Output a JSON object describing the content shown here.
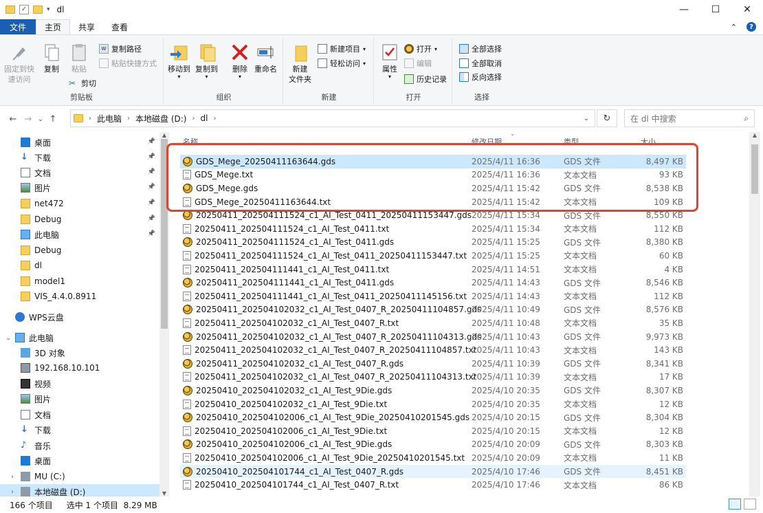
{
  "window": {
    "title": "dl",
    "minimize": "—",
    "maximize": "☐",
    "close": "✕"
  },
  "tabs": {
    "file": "文件",
    "home": "主页",
    "share": "共享",
    "view": "查看",
    "collapse": "⌃"
  },
  "ribbon": {
    "clipboard": {
      "label": "剪贴板",
      "pin": "固定到快\n速访问",
      "copy": "复制",
      "paste": "粘贴",
      "copy_path": "复制路径",
      "paste_shortcut": "粘贴快捷方式",
      "cut": "剪切"
    },
    "organize": {
      "label": "组织",
      "move_to": "移动到",
      "copy_to": "复制到",
      "delete": "删除",
      "rename": "重命名"
    },
    "new": {
      "label": "新建",
      "new_folder": "新建\n文件夹",
      "new_item": "新建项目",
      "easy_access": "轻松访问"
    },
    "open": {
      "label": "打开",
      "properties": "属性",
      "open": "打开",
      "edit": "编辑",
      "history": "历史记录"
    },
    "select": {
      "label": "选择",
      "select_all": "全部选择",
      "select_none": "全部取消",
      "invert": "反向选择"
    }
  },
  "address": {
    "back": "←",
    "forward": "→",
    "recent": "⌄",
    "up": "↑",
    "crumbs": [
      "此电脑",
      "本地磁盘 (D:)",
      "dl"
    ],
    "refresh": "↻",
    "search_placeholder": "在 dl 中搜索",
    "search_icon": "⌕"
  },
  "nav": {
    "items": [
      {
        "label": "桌面",
        "icon": "desktop-icon",
        "pinned": true
      },
      {
        "label": "下载",
        "icon": "download-icon",
        "pinned": true
      },
      {
        "label": "文档",
        "icon": "document-icon",
        "pinned": true
      },
      {
        "label": "图片",
        "icon": "picture-icon",
        "pinned": true
      },
      {
        "label": "net472",
        "icon": "folder-icon",
        "pinned": true
      },
      {
        "label": "Debug",
        "icon": "folder-icon",
        "pinned": true
      },
      {
        "label": "此电脑",
        "icon": "computer-icon",
        "pinned": true
      },
      {
        "label": "Debug",
        "icon": "folder-icon",
        "pinned": false
      },
      {
        "label": "dl",
        "icon": "folder-icon",
        "pinned": false
      },
      {
        "label": "model1",
        "icon": "folder-icon",
        "pinned": false
      },
      {
        "label": "VIS_4.4.0.8911",
        "icon": "folder-icon",
        "pinned": false
      },
      {
        "label": "WPS云盘",
        "icon": "cloud-icon",
        "pinned": false
      },
      {
        "label": "此电脑",
        "icon": "computer-icon",
        "pinned": false
      },
      {
        "label": "3D 对象",
        "icon": "cube-icon",
        "pinned": false
      },
      {
        "label": "192.168.10.101",
        "icon": "network-drive-icon",
        "pinned": false
      },
      {
        "label": "视频",
        "icon": "video-icon",
        "pinned": false
      },
      {
        "label": "图片",
        "icon": "picture-icon",
        "pinned": false
      },
      {
        "label": "文档",
        "icon": "document-icon",
        "pinned": false
      },
      {
        "label": "下载",
        "icon": "download-icon",
        "pinned": false
      },
      {
        "label": "音乐",
        "icon": "music-icon",
        "pinned": false
      },
      {
        "label": "桌面",
        "icon": "desktop-icon",
        "pinned": false
      },
      {
        "label": "MU (C:)",
        "icon": "drive-icon",
        "pinned": false
      },
      {
        "label": "本地磁盘 (D:)",
        "icon": "drive-icon",
        "pinned": false
      }
    ]
  },
  "columns": {
    "name": "名称",
    "date": "修改日期",
    "type": "类型",
    "size": "大小"
  },
  "files": [
    {
      "name": "GDS_Mege_20250411163644.gds",
      "date": "2025/4/11 16:36",
      "type": "GDS 文件",
      "size": "8,497 KB",
      "kind": "gds"
    },
    {
      "name": "GDS_Mege.txt",
      "date": "2025/4/11 16:36",
      "type": "文本文档",
      "size": "93 KB",
      "kind": "txt"
    },
    {
      "name": "GDS_Mege.gds",
      "date": "2025/4/11 15:42",
      "type": "GDS 文件",
      "size": "8,538 KB",
      "kind": "gds"
    },
    {
      "name": "GDS_Mege_20250411163644.txt",
      "date": "2025/4/11 15:42",
      "type": "文本文档",
      "size": "109 KB",
      "kind": "txt"
    },
    {
      "name": "20250411_202504111524_c1_AI_Test_0411_20250411153447.gds",
      "date": "2025/4/11 15:34",
      "type": "GDS 文件",
      "size": "8,550 KB",
      "kind": "gds"
    },
    {
      "name": "20250411_202504111524_c1_AI_Test_0411.txt",
      "date": "2025/4/11 15:34",
      "type": "文本文档",
      "size": "112 KB",
      "kind": "txt"
    },
    {
      "name": "20250411_202504111524_c1_AI_Test_0411.gds",
      "date": "2025/4/11 15:25",
      "type": "GDS 文件",
      "size": "8,380 KB",
      "kind": "gds"
    },
    {
      "name": "20250411_202504111524_c1_AI_Test_0411_20250411153447.txt",
      "date": "2025/4/11 15:25",
      "type": "文本文档",
      "size": "60 KB",
      "kind": "txt"
    },
    {
      "name": "20250411_202504111441_c1_AI_Test_0411.txt",
      "date": "2025/4/11 14:51",
      "type": "文本文档",
      "size": "4 KB",
      "kind": "txt"
    },
    {
      "name": "20250411_202504111441_c1_AI_Test_0411.gds",
      "date": "2025/4/11 14:43",
      "type": "GDS 文件",
      "size": "8,546 KB",
      "kind": "gds"
    },
    {
      "name": "20250411_202504111441_c1_AI_Test_0411_20250411145156.txt",
      "date": "2025/4/11 14:43",
      "type": "文本文档",
      "size": "112 KB",
      "kind": "txt"
    },
    {
      "name": "20250411_202504102032_c1_AI_Test_0407_R_20250411104857.gds",
      "date": "2025/4/11 10:49",
      "type": "GDS 文件",
      "size": "8,576 KB",
      "kind": "gds"
    },
    {
      "name": "20250411_202504102032_c1_AI_Test_0407_R.txt",
      "date": "2025/4/11 10:48",
      "type": "文本文档",
      "size": "35 KB",
      "kind": "txt"
    },
    {
      "name": "20250411_202504102032_c1_AI_Test_0407_R_20250411104313.gds",
      "date": "2025/4/11 10:43",
      "type": "GDS 文件",
      "size": "9,973 KB",
      "kind": "gds"
    },
    {
      "name": "20250411_202504102032_c1_AI_Test_0407_R_20250411104857.txt",
      "date": "2025/4/11 10:43",
      "type": "文本文档",
      "size": "143 KB",
      "kind": "txt"
    },
    {
      "name": "20250411_202504102032_c1_AI_Test_0407_R.gds",
      "date": "2025/4/11 10:39",
      "type": "GDS 文件",
      "size": "8,341 KB",
      "kind": "gds"
    },
    {
      "name": "20250411_202504102032_c1_AI_Test_0407_R_20250411104313.txt",
      "date": "2025/4/11 10:39",
      "type": "文本文档",
      "size": "17 KB",
      "kind": "txt"
    },
    {
      "name": "20250410_202504102032_c1_AI_Test_9Die.gds",
      "date": "2025/4/10 20:35",
      "type": "GDS 文件",
      "size": "8,307 KB",
      "kind": "gds"
    },
    {
      "name": "20250410_202504102032_c1_AI_Test_9Die.txt",
      "date": "2025/4/10 20:35",
      "type": "文本文档",
      "size": "12 KB",
      "kind": "txt"
    },
    {
      "name": "20250410_202504102006_c1_AI_Test_9Die_20250410201545.gds",
      "date": "2025/4/10 20:15",
      "type": "GDS 文件",
      "size": "8,304 KB",
      "kind": "gds"
    },
    {
      "name": "20250410_202504102006_c1_AI_Test_9Die.txt",
      "date": "2025/4/10 20:15",
      "type": "文本文档",
      "size": "12 KB",
      "kind": "txt"
    },
    {
      "name": "20250410_202504102006_c1_AI_Test_9Die.gds",
      "date": "2025/4/10 20:09",
      "type": "GDS 文件",
      "size": "8,303 KB",
      "kind": "gds"
    },
    {
      "name": "20250410_202504102006_c1_AI_Test_9Die_20250410201545.txt",
      "date": "2025/4/10 20:09",
      "type": "文本文档",
      "size": "11 KB",
      "kind": "txt"
    },
    {
      "name": "20250410_202504101744_c1_AI_Test_0407_R.gds",
      "date": "2025/4/10 17:46",
      "type": "GDS 文件",
      "size": "8,451 KB",
      "kind": "gds"
    },
    {
      "name": "20250410_202504101744_c1_AI_Test_0407_R.txt",
      "date": "2025/4/10 17:46",
      "type": "文本文档",
      "size": "86 KB",
      "kind": "txt"
    }
  ],
  "status": {
    "count": "166 个项目",
    "selected": "选中 1 个项目  8.29 MB"
  },
  "colors": {
    "file_tab": "#1a5fb4",
    "selection": "#cce8ff",
    "highlight_box": "#e0442c"
  }
}
